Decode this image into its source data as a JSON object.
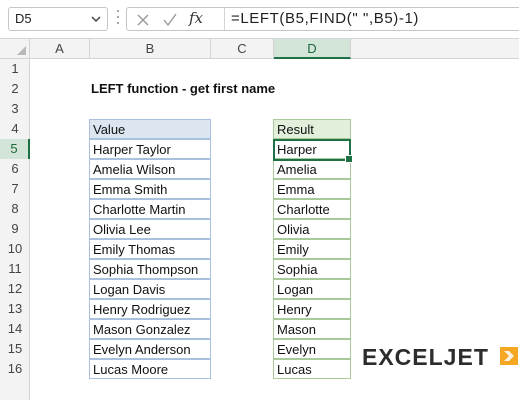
{
  "formula_bar": {
    "name_box": "D5",
    "formula": "=LEFT(B5,FIND(\" \",B5)-1)",
    "fx_label": "fx"
  },
  "columns": [
    "A",
    "B",
    "C",
    "D"
  ],
  "rows": [
    "1",
    "2",
    "3",
    "4",
    "5",
    "6",
    "7",
    "8",
    "9",
    "10",
    "11",
    "12",
    "13",
    "14",
    "15",
    "16"
  ],
  "selected_column": "D",
  "selected_row": "5",
  "sheet": {
    "title": "LEFT function - get first name",
    "value_header": "Value",
    "result_header": "Result",
    "values": [
      "Harper Taylor",
      "Amelia Wilson",
      "Emma Smith",
      "Charlotte Martin",
      "Olivia Lee",
      "Emily Thomas",
      "Sophia Thompson",
      "Logan Davis",
      "Henry Rodriguez",
      "Mason Gonzalez",
      "Evelyn Anderson",
      "Lucas Moore"
    ],
    "results": [
      "Harper",
      "Amelia",
      "Emma",
      "Charlotte",
      "Olivia",
      "Emily",
      "Sophia",
      "Logan",
      "Henry",
      "Mason",
      "Evelyn",
      "Lucas"
    ]
  },
  "logo": {
    "text": "EXCELJET",
    "accent_color": "#f5a623"
  },
  "colors": {
    "selection": "#1e7145",
    "value_header_fill": "#dce6f1",
    "result_header_fill": "#e2efda"
  }
}
